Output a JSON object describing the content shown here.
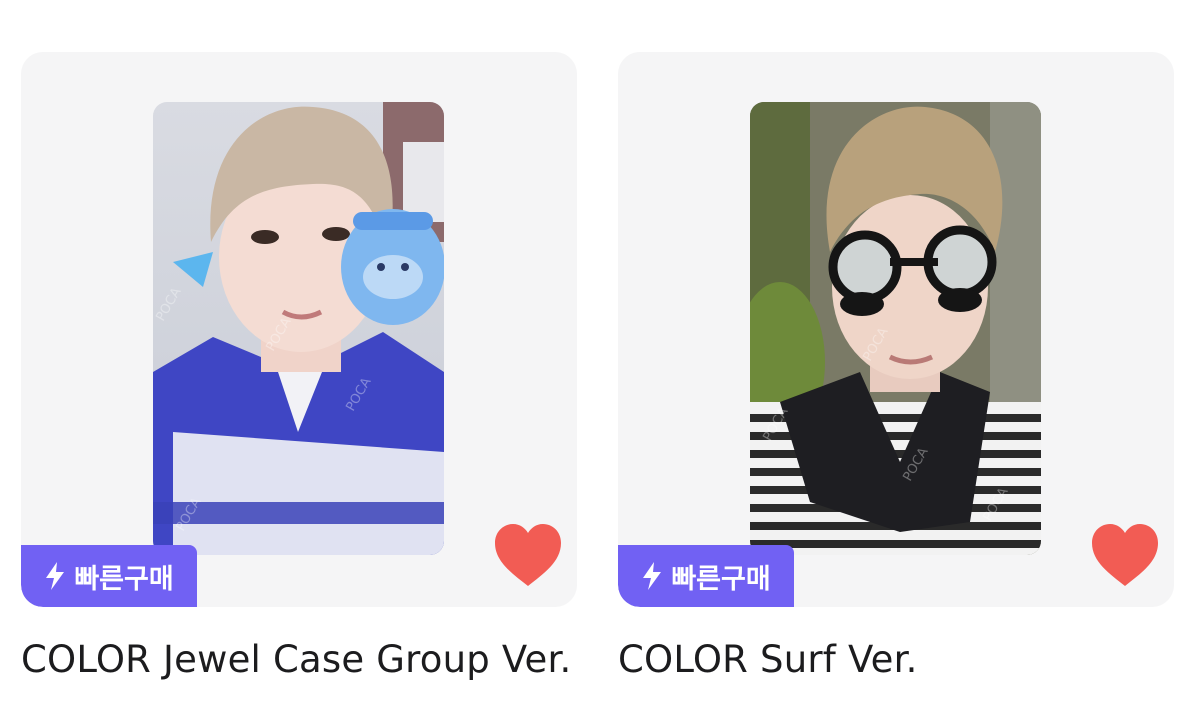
{
  "products": [
    {
      "title": "COLOR Jewel Case Group Ver.",
      "badge": {
        "label": "빠른구매",
        "icon": "lightning-bolt-icon"
      },
      "favorite": {
        "icon": "heart-icon",
        "active": true
      },
      "watermark": "POCA",
      "colors": {
        "badge": "#7161f3",
        "heart": "#f25c54",
        "card": "#f5f5f6"
      }
    },
    {
      "title": "COLOR Surf Ver.",
      "badge": {
        "label": "빠른구매",
        "icon": "lightning-bolt-icon"
      },
      "favorite": {
        "icon": "heart-icon",
        "active": true
      },
      "watermark": "POCA",
      "colors": {
        "badge": "#7161f3",
        "heart": "#f25c54",
        "card": "#f5f5f6"
      }
    }
  ]
}
